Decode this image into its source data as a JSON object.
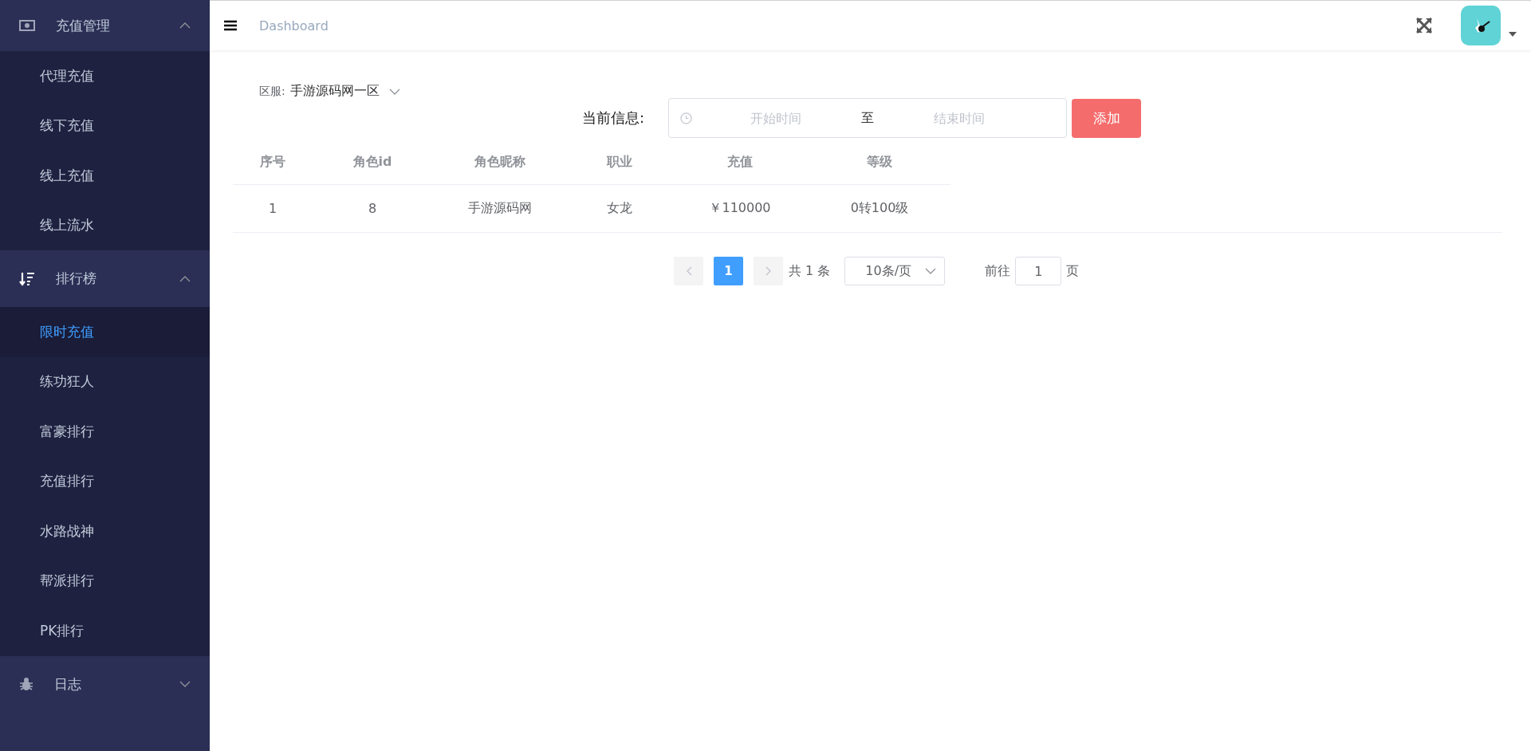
{
  "sidebar": {
    "groups": [
      {
        "label": "充值管理",
        "expanded": true,
        "items": [
          {
            "label": "代理充值",
            "selected": false
          },
          {
            "label": "线下充值",
            "selected": false
          },
          {
            "label": "线上充值",
            "selected": false
          },
          {
            "label": "线上流水",
            "selected": false
          }
        ]
      },
      {
        "label": "排行榜",
        "expanded": true,
        "items": [
          {
            "label": "限时充值",
            "selected": true
          },
          {
            "label": "练功狂人",
            "selected": false
          },
          {
            "label": "富豪排行",
            "selected": false
          },
          {
            "label": "充值排行",
            "selected": false
          },
          {
            "label": "水路战神",
            "selected": false
          },
          {
            "label": "帮派排行",
            "selected": false
          },
          {
            "label": "PK排行",
            "selected": false
          }
        ]
      },
      {
        "label": "日志",
        "expanded": false
      }
    ]
  },
  "header": {
    "breadcrumb": "Dashboard"
  },
  "filter": {
    "label": "区服:",
    "value": "手游源码网一区"
  },
  "info": {
    "label": "当前信息:",
    "start_placeholder": "开始时间",
    "separator": "至",
    "end_placeholder": "结束时间",
    "button": "添加"
  },
  "table": {
    "columns": [
      "序号",
      "角色id",
      "角色昵称",
      "职业",
      "充值",
      "等级"
    ],
    "rows": [
      [
        "1",
        "8",
        "手游源码网",
        "女龙",
        "￥110000",
        "0转100级"
      ]
    ]
  },
  "pagination": {
    "pages": [
      {
        "label": "1",
        "selected": true
      }
    ],
    "prev_disabled": true,
    "next_disabled": true,
    "total": "共 1 条",
    "page_size": "10条/页",
    "goto_label": "前往",
    "goto_value": "1",
    "goto_suffix": "页"
  }
}
